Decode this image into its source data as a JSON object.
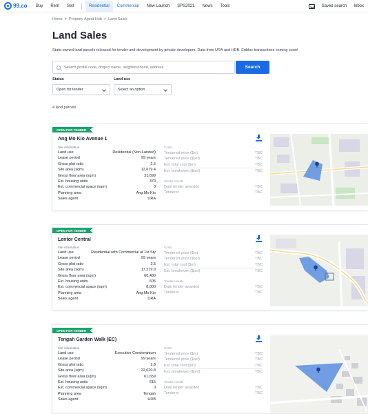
{
  "header": {
    "logo_text": "99.co",
    "nav": [
      "Buy",
      "Rent",
      "Sell",
      "Residential",
      "Commercial",
      "New Launch",
      "SPS2021",
      "News",
      "Tools"
    ],
    "saved_search": "Saved search",
    "inbox": "Inbox"
  },
  "breadcrumb": [
    "Home",
    ">",
    "Property Agent Hub",
    ">",
    "Land Sales"
  ],
  "page": {
    "title": "Land Sales",
    "description": "State-owned land parcels released for tender and development by private developers. Data from URA and HDB. Enbloc transactions coming soon!"
  },
  "search": {
    "placeholder": "Search postal code, project name, neighbourhood, address",
    "button": "Search"
  },
  "filters": {
    "status_label": "Status",
    "status_value": "Open for tender",
    "landuse_label": "Land use",
    "landuse_value": "Select an option"
  },
  "result_count": "4 land parcels",
  "labels": {
    "site_information": "Site information",
    "land_use": "Land use",
    "lease_period": "Lease period",
    "gross_plot_ratio": "Gross plot ratio",
    "site_area": "Site area (sqm)",
    "gross_floor_area": "Gross floor area (sqm)",
    "est_housing_units": "Est. housing units",
    "est_commercial_space": "Est. commercial space (sqm)",
    "planning_area": "Planning area",
    "sales_agent": "Sales agent",
    "costs": "Costs",
    "tendered_price_sm": "Tendered price ($m)",
    "tendered_price_spsf": "Tendered price ($psf)",
    "est_total_cost": "Est. total cost ($m)",
    "est_breakeven": "Est. breakeven ($psf)",
    "tender_results": "Tender results",
    "date_tender_awarded": "Date tender awarded",
    "tenderer": "Tenderer",
    "tbc": "TBC"
  },
  "parcels": [
    {
      "badge": "OPEN FOR TENDER",
      "name": "Ang Mo Kio Avenue 1",
      "land_use": "Residential (Non-Landed)",
      "lease_period": "99 years",
      "gross_plot_ratio": "2.5",
      "site_area": "12,679.4",
      "gross_floor_area": "31,699",
      "est_housing_units": "370",
      "est_commercial_space": "0",
      "planning_area": "Ang Mo Kio",
      "sales_agent": "URA"
    },
    {
      "badge": "OPEN FOR TENDER",
      "name": "Lentor Central",
      "land_use": "Residential with Commercial at 1st Sty",
      "lease_period": "99 years",
      "gross_plot_ratio": "3.5",
      "site_area": "17,279.9",
      "gross_floor_area": "60,480",
      "est_housing_units": "605",
      "est_commercial_space": "8,000",
      "planning_area": "Ang Mo Kio",
      "sales_agent": "URA"
    },
    {
      "badge": "OPEN FOR TENDER",
      "name": "Tengah Garden Walk (EC)",
      "land_use": "Executive Condominium",
      "lease_period": "99 years",
      "gross_plot_ratio": "2.8",
      "site_area": "22,020.8",
      "gross_floor_area": "61,659",
      "est_housing_units": "615",
      "est_commercial_space": "0",
      "planning_area": "Tengah",
      "sales_agent": "HDB"
    }
  ],
  "colors": {
    "brand_blue": "#1a6be3",
    "badge_green": "#1aa36b",
    "parcel_fill": "#5b8fe0"
  }
}
